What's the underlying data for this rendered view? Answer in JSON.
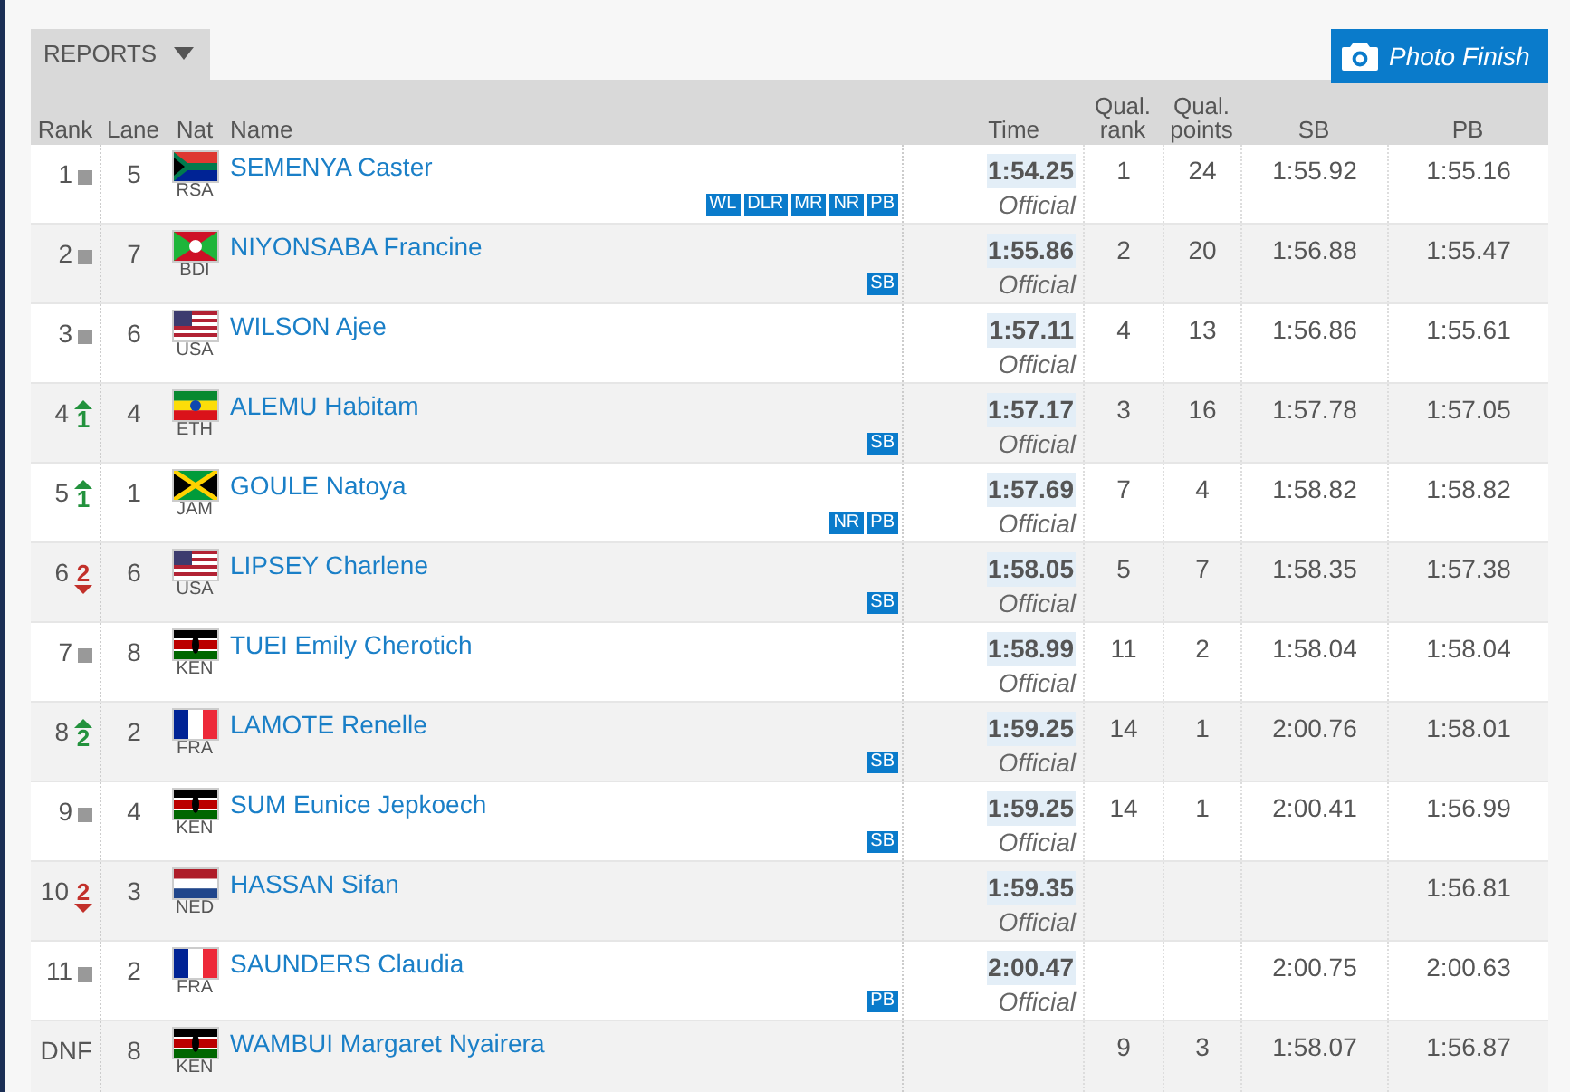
{
  "reports_menu": {
    "label": "REPORTS"
  },
  "photo_finish_button": {
    "label": "Photo Finish"
  },
  "table": {
    "columns": [
      "Rank",
      "Lane",
      "Nat",
      "Name",
      "Time",
      "Qual. rank",
      "Qual. points",
      "SB",
      "PB"
    ],
    "rows": [
      {
        "rank": "1",
        "move": {
          "kind": "same"
        },
        "lane": "5",
        "nat": "RSA",
        "flag": {
          "kind": "rsa"
        },
        "name": "SEMENYA Caster",
        "badges": [
          "WL",
          "DLR",
          "MR",
          "NR",
          "PB"
        ],
        "time": "1:54.25",
        "status": "Official",
        "qual_rank": "1",
        "qual_points": "24",
        "sb": "1:55.92",
        "pb": "1:55.16"
      },
      {
        "rank": "2",
        "move": {
          "kind": "same"
        },
        "lane": "7",
        "nat": "BDI",
        "flag": {
          "kind": "bdi"
        },
        "name": "NIYONSABA Francine",
        "badges": [
          "SB"
        ],
        "time": "1:55.86",
        "status": "Official",
        "qual_rank": "2",
        "qual_points": "20",
        "sb": "1:56.88",
        "pb": "1:55.47"
      },
      {
        "rank": "3",
        "move": {
          "kind": "same"
        },
        "lane": "6",
        "nat": "USA",
        "flag": {
          "kind": "usa"
        },
        "name": "WILSON Ajee",
        "badges": [],
        "time": "1:57.11",
        "status": "Official",
        "qual_rank": "4",
        "qual_points": "13",
        "sb": "1:56.86",
        "pb": "1:55.61"
      },
      {
        "rank": "4",
        "move": {
          "kind": "up",
          "value": "1"
        },
        "lane": "4",
        "nat": "ETH",
        "flag": {
          "kind": "eth"
        },
        "name": "ALEMU Habitam",
        "badges": [
          "SB"
        ],
        "time": "1:57.17",
        "status": "Official",
        "qual_rank": "3",
        "qual_points": "16",
        "sb": "1:57.78",
        "pb": "1:57.05"
      },
      {
        "rank": "5",
        "move": {
          "kind": "up",
          "value": "1"
        },
        "lane": "1",
        "nat": "JAM",
        "flag": {
          "kind": "jam"
        },
        "name": "GOULE Natoya",
        "badges": [
          "NR",
          "PB"
        ],
        "time": "1:57.69",
        "status": "Official",
        "qual_rank": "7",
        "qual_points": "4",
        "sb": "1:58.82",
        "pb": "1:58.82"
      },
      {
        "rank": "6",
        "move": {
          "kind": "down",
          "value": "2"
        },
        "lane": "6",
        "nat": "USA",
        "flag": {
          "kind": "usa"
        },
        "name": "LIPSEY Charlene",
        "badges": [
          "SB"
        ],
        "time": "1:58.05",
        "status": "Official",
        "qual_rank": "5",
        "qual_points": "7",
        "sb": "1:58.35",
        "pb": "1:57.38"
      },
      {
        "rank": "7",
        "move": {
          "kind": "same"
        },
        "lane": "8",
        "nat": "KEN",
        "flag": {
          "kind": "ken"
        },
        "name": "TUEI Emily Cherotich",
        "badges": [],
        "time": "1:58.99",
        "status": "Official",
        "qual_rank": "11",
        "qual_points": "2",
        "sb": "1:58.04",
        "pb": "1:58.04"
      },
      {
        "rank": "8",
        "move": {
          "kind": "up",
          "value": "2"
        },
        "lane": "2",
        "nat": "FRA",
        "flag": {
          "kind": "fra"
        },
        "name": "LAMOTE Renelle",
        "badges": [
          "SB"
        ],
        "time": "1:59.25",
        "status": "Official",
        "qual_rank": "14",
        "qual_points": "1",
        "sb": "2:00.76",
        "pb": "1:58.01"
      },
      {
        "rank": "9",
        "move": {
          "kind": "same"
        },
        "lane": "4",
        "nat": "KEN",
        "flag": {
          "kind": "ken"
        },
        "name": "SUM Eunice Jepkoech",
        "badges": [
          "SB"
        ],
        "time": "1:59.25",
        "status": "Official",
        "qual_rank": "14",
        "qual_points": "1",
        "sb": "2:00.41",
        "pb": "1:56.99"
      },
      {
        "rank": "10",
        "move": {
          "kind": "down",
          "value": "2"
        },
        "lane": "3",
        "nat": "NED",
        "flag": {
          "kind": "ned"
        },
        "name": "HASSAN Sifan",
        "badges": [],
        "time": "1:59.35",
        "status": "Official",
        "pb": "1:56.81"
      },
      {
        "rank": "11",
        "move": {
          "kind": "same"
        },
        "lane": "2",
        "nat": "FRA",
        "flag": {
          "kind": "fra"
        },
        "name": "SAUNDERS Claudia",
        "badges": [
          "PB"
        ],
        "time": "2:00.47",
        "status": "Official",
        "sb": "2:00.75",
        "pb": "2:00.63"
      },
      {
        "rank": "DNF",
        "lane": "8",
        "nat": "KEN",
        "flag": {
          "kind": "ken"
        },
        "name": "WAMBUI Margaret Nyairera",
        "badges": [],
        "qual_rank": "9",
        "qual_points": "3",
        "sb": "1:58.07",
        "pb": "1:56.87"
      }
    ]
  }
}
